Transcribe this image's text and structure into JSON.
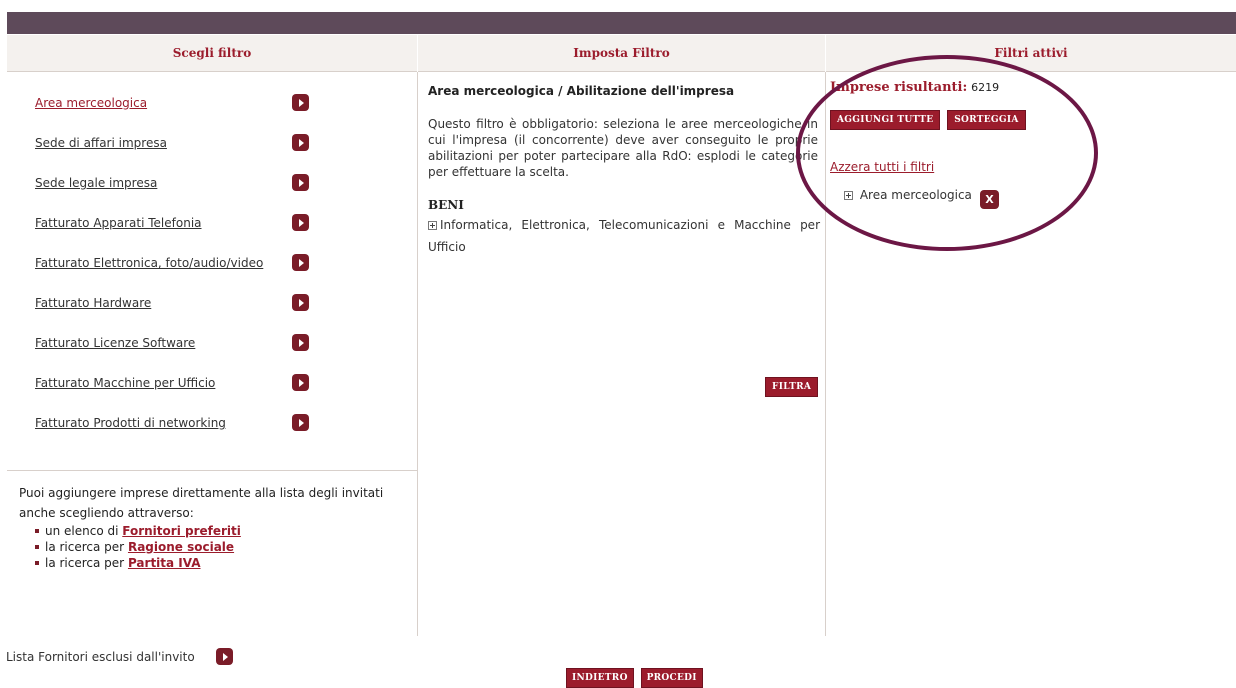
{
  "headers": {
    "scegli": "Scegli filtro",
    "imposta": "Imposta Filtro",
    "attivi": "Filtri attivi"
  },
  "filters": [
    {
      "label": "Area merceologica",
      "active": true
    },
    {
      "label": "Sede di affari impresa"
    },
    {
      "label": "Sede legale impresa"
    },
    {
      "label": "Fatturato Apparati Telefonia"
    },
    {
      "label": "Fatturato Elettronica, foto/audio/video"
    },
    {
      "label": "Fatturato Hardware"
    },
    {
      "label": "Fatturato Licenze Software"
    },
    {
      "label": "Fatturato Macchine per Ufficio"
    },
    {
      "label": "Fatturato Prodotti di networking"
    }
  ],
  "help": {
    "intro": "Puoi aggiungere imprese direttamente alla lista degli invitati anche scegliendo attraverso:",
    "items": [
      {
        "prefix": "un elenco di",
        "link": "Fornitori preferiti"
      },
      {
        "prefix": "la ricerca per",
        "link": "Ragione sociale"
      },
      {
        "prefix": "la ricerca per",
        "link": "Partita IVA"
      }
    ]
  },
  "imposta": {
    "title": "Area merceologica / Abilitazione dell'impresa",
    "description": "Questo filtro è obbligatorio: seleziona le aree merceologiche in cui l'impresa (il concorrente) deve aver conseguito le proprie abilitazioni per poter partecipare alla RdO: esplodi le categorie per effettuare la scelta.",
    "group": "BENI",
    "tree_item": "Informatica, Elettronica, Telecomunicazioni e Macchine per Ufficio",
    "filtra": "FILTRA"
  },
  "attivi": {
    "imprese_label": "Imprese risultanti:",
    "imprese_count": "6219",
    "aggiungi": "AGGIUNGI TUTTE",
    "sorteggia": "SORTEGGIA",
    "azzera": "Azzera tutti i filtri",
    "active_filter": "Area merceologica",
    "remove": "X"
  },
  "footer": {
    "excluded": "Lista Fornitori esclusi dall'invito",
    "indietro": "INDIETRO",
    "procedi": "PROCEDI"
  },
  "colors": {
    "accent": "#9b1c2c",
    "topbar": "#5e4a5a",
    "highlight_ring": "#6c1745"
  }
}
